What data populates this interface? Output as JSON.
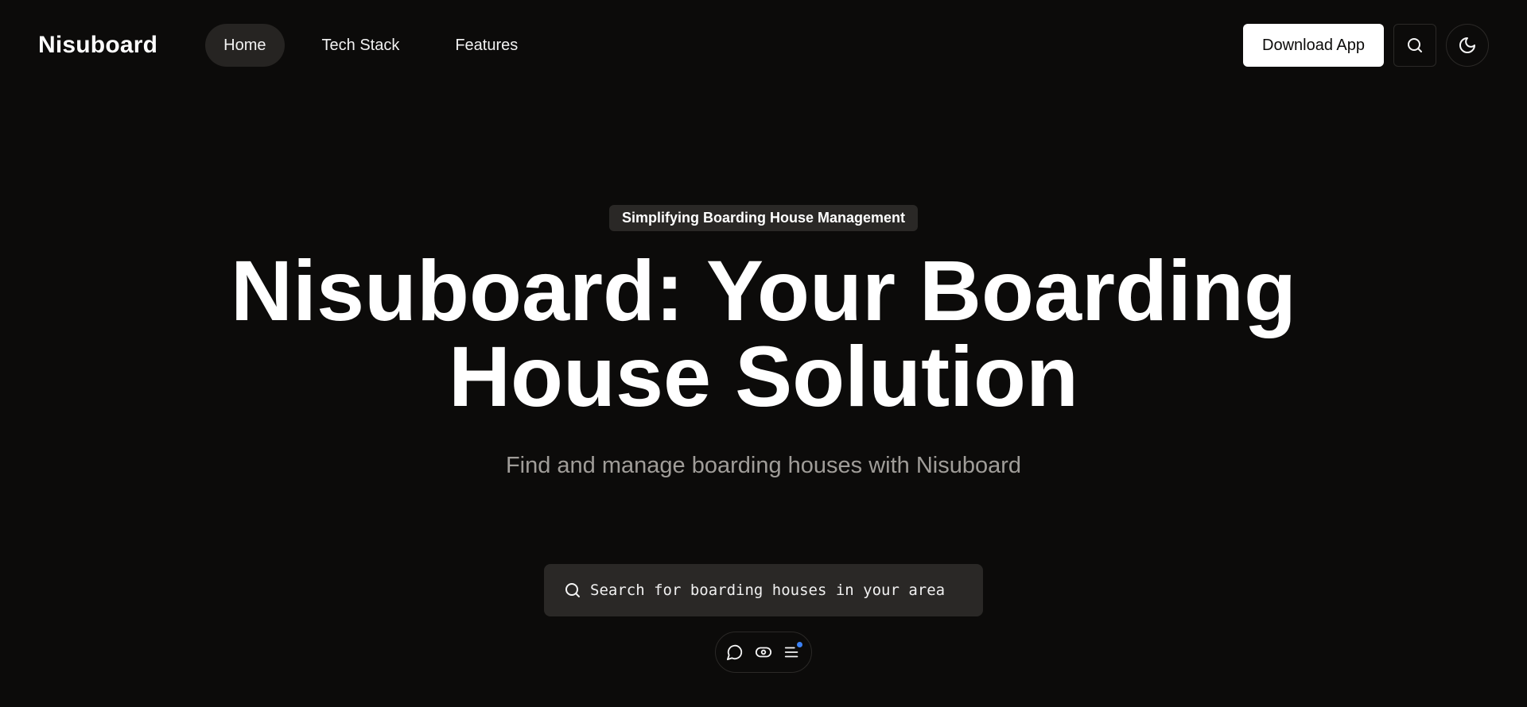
{
  "header": {
    "brand": "Nisuboard",
    "nav": [
      {
        "label": "Home",
        "active": true
      },
      {
        "label": "Tech Stack",
        "active": false
      },
      {
        "label": "Features",
        "active": false
      }
    ],
    "download_label": "Download App",
    "search_icon": "search-icon",
    "theme_icon": "moon-icon"
  },
  "hero": {
    "eyebrow": "Simplifying Boarding House Management",
    "title_line1": "Nisuboard: Your Boarding",
    "title_line2": "House Solution",
    "subtitle": "Find and manage boarding houses with Nisuboard",
    "search_text": "Search for boarding houses in your area"
  },
  "toolbar": {
    "icons": [
      "chat-icon",
      "eye-icon",
      "menu-icon"
    ],
    "notification_color": "#3b82f6"
  },
  "colors": {
    "background": "#0c0b0a",
    "surface": "#2a2826",
    "text": "#ffffff",
    "muted": "#a09d99"
  }
}
